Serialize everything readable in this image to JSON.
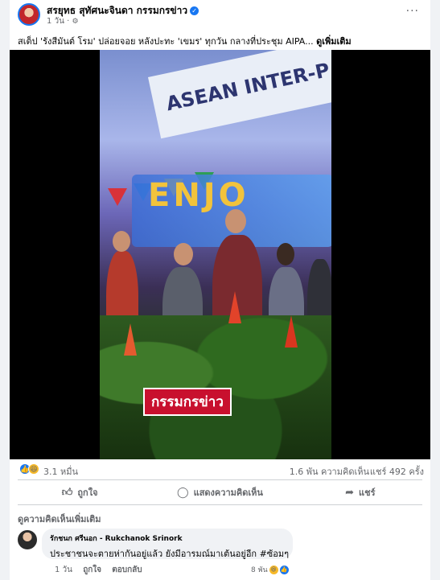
{
  "post": {
    "author": "สรยุทธ สุทัศนะจินดา กรรมกรข่าว",
    "time": "1 วัน",
    "privacy_icon": "gear-icon",
    "more_label": "···",
    "caption": "สเต็ป 'รังสีมันต์ โรม' ปล่อยจอย หลังปะทะ 'เขมร' ทุกวัน กลางที่ประชุม AIPA...",
    "see_more": "ดูเพิ่มเติม"
  },
  "video": {
    "banner_text": "ASEAN INTER-P",
    "screen_text": "ENJO",
    "watermark": "กรรมกรข่าว"
  },
  "stats": {
    "reaction_count": "3.1 หมื่น",
    "comment_count": "1.6 พัน ความคิดเห็น",
    "share_count": "แชร์ 492 ครั้ง"
  },
  "actions": {
    "like": "ถูกใจ",
    "comment": "แสดงความคิดเห็น",
    "share": "แชร์"
  },
  "comments_section": {
    "view_more": "ดูความคิดเห็นเพิ่มเติม",
    "comment": {
      "name": "รักชนก ศรีนอก - Rukchanok Srinork",
      "text": "ประชาชนจะตายห่ากันอยู่แล้ว ยังมีอารมณ์มาเต้นอยู่อีก #ซ้อมๆ",
      "time": "1 วัน",
      "like": "ถูกใจ",
      "reply": "ตอบกลับ",
      "reaction_count": "8 พัน"
    }
  },
  "colors": {
    "accent": "#1877f2",
    "watermark_bg": "#c8102e"
  }
}
